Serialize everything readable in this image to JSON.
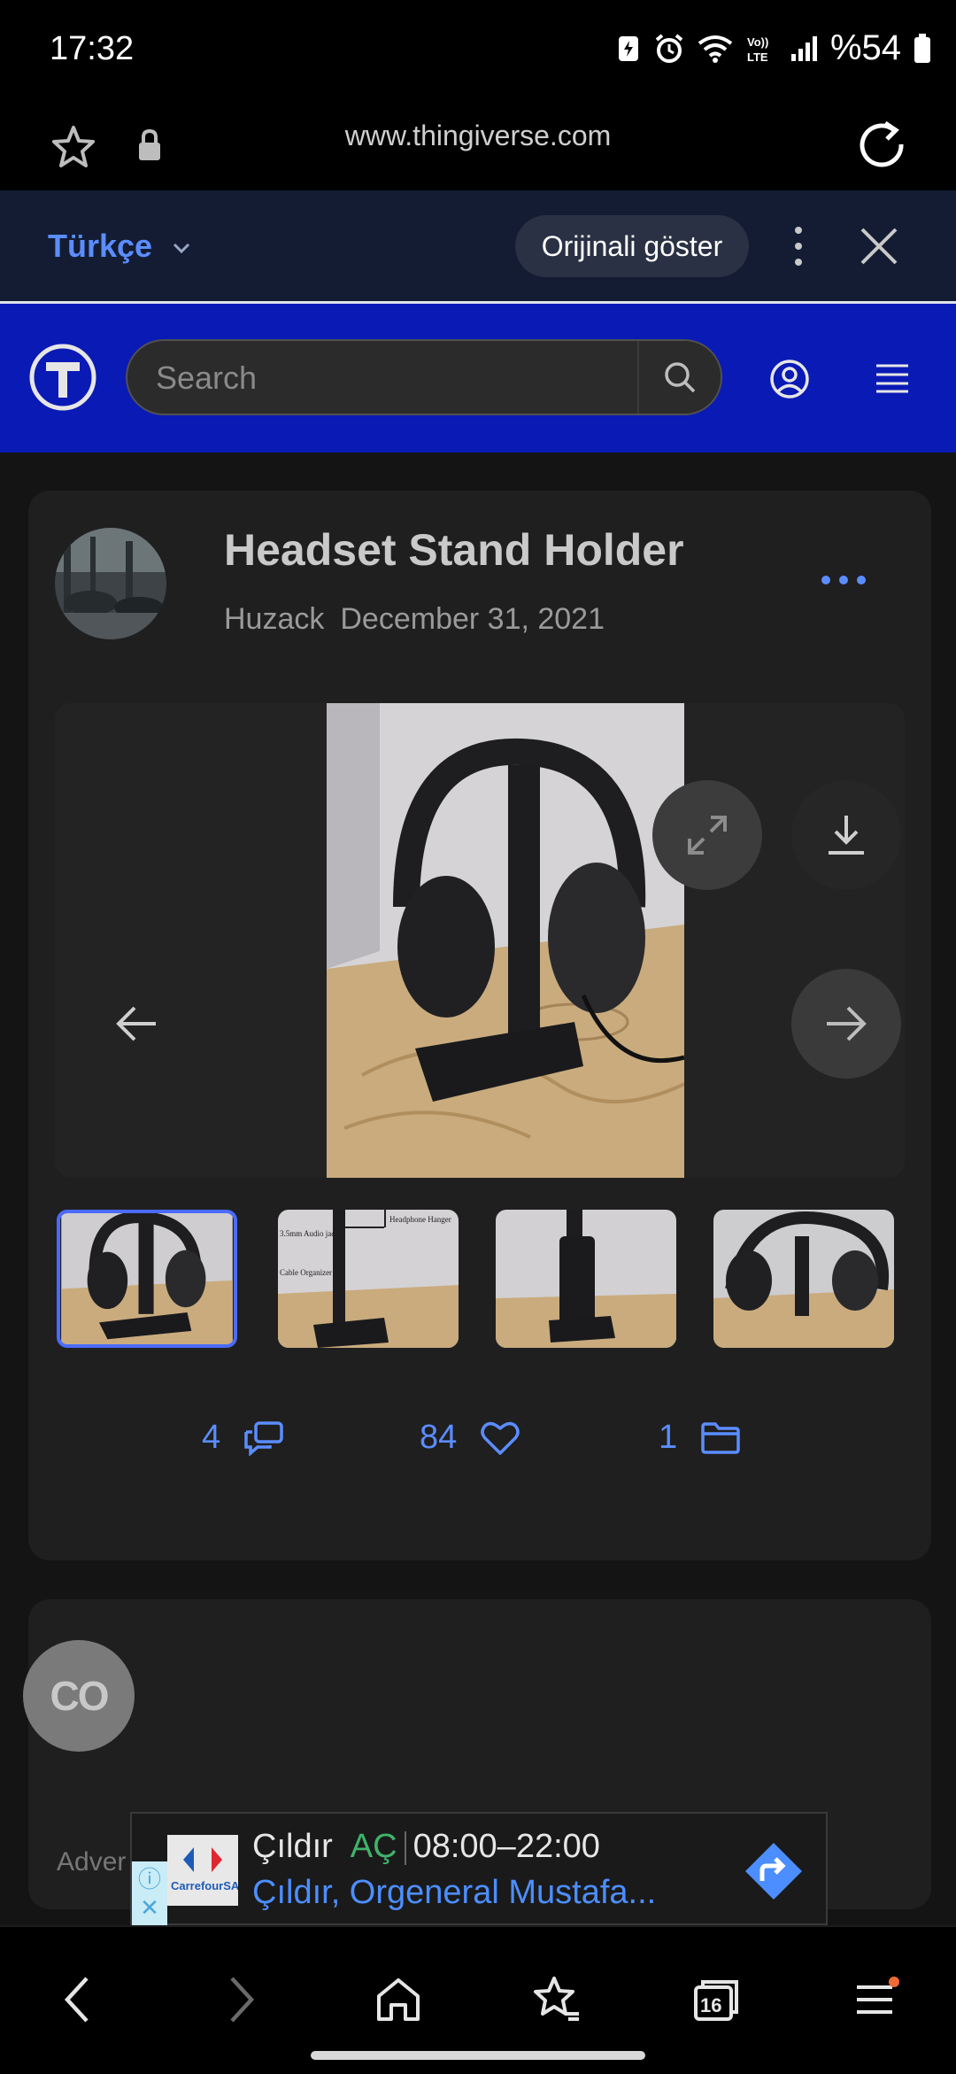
{
  "status_bar": {
    "time": "17:32",
    "battery": "%54"
  },
  "url_bar": {
    "url": "www.thingiverse.com"
  },
  "translate_bar": {
    "language": "Türkçe",
    "show_original": "Orijinali göster"
  },
  "site_header": {
    "logo": "T",
    "search_placeholder": "Search"
  },
  "thing": {
    "title": "Headset Stand Holder",
    "author": "Huzack",
    "date": "December 31, 2021",
    "stats": {
      "comments": "4",
      "likes": "84",
      "collections": "1"
    }
  },
  "thumbnails": [
    {
      "selected": true,
      "labels": []
    },
    {
      "selected": false,
      "labels": [
        "3.5mm Audio jack",
        "Headphone Hanger",
        "Cable Organizer"
      ]
    },
    {
      "selected": false,
      "labels": []
    },
    {
      "selected": false,
      "labels": []
    }
  ],
  "floating_button": {
    "label": "CO"
  },
  "advert_label": "Adver",
  "ad": {
    "place": "Çıldır",
    "status": "AÇ",
    "hours": "08:00–22:00",
    "address": "Çıldır, Orgeneral Mustafa...",
    "logo_text": "CarrefourSA"
  },
  "bottom_nav": {
    "tabs_count": "16"
  },
  "colors": {
    "accent": "#5b8dff",
    "header_blue": "#0a1ab5",
    "card": "#1f1f1f",
    "ad_open": "#3fb36b"
  }
}
